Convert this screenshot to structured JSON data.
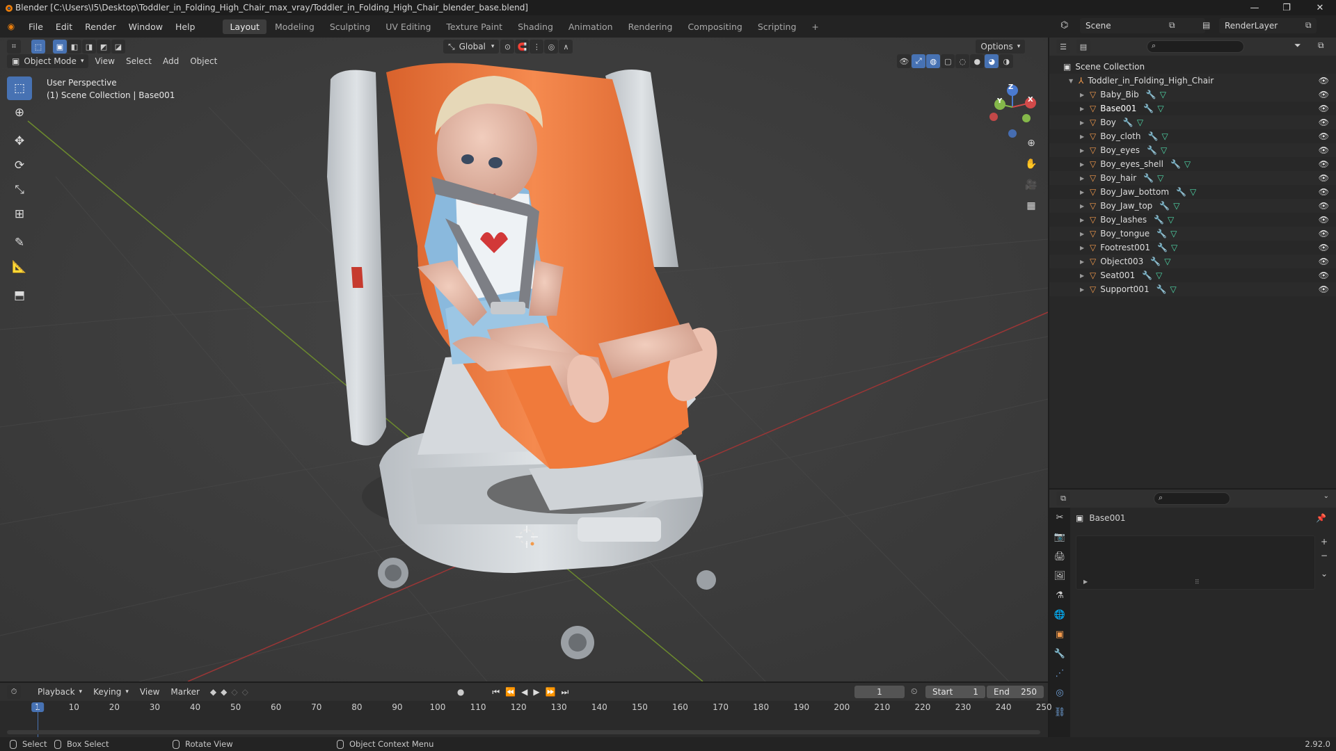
{
  "window": {
    "title": "Blender [C:\\Users\\I5\\Desktop\\Toddler_in_Folding_High_Chair_max_vray/Toddler_in_Folding_High_Chair_blender_base.blend]",
    "minimize": "—",
    "maximize": "❐",
    "close": "✕"
  },
  "menu": {
    "items": [
      "File",
      "Edit",
      "Render",
      "Window",
      "Help"
    ],
    "workspaces": [
      "Layout",
      "Modeling",
      "Sculpting",
      "UV Editing",
      "Texture Paint",
      "Shading",
      "Animation",
      "Rendering",
      "Compositing",
      "Scripting"
    ],
    "active_workspace": "Layout",
    "add_tab": "+",
    "scene": "Scene",
    "view_layer": "RenderLayer"
  },
  "viewport": {
    "mode": "Object Mode",
    "menus": [
      "View",
      "Select",
      "Add",
      "Object"
    ],
    "transform_orientation": "Global",
    "options": "Options",
    "info_line1": "User Perspective",
    "info_line2": "(1) Scene Collection | Base001",
    "gizmo": {
      "x": "X",
      "y": "Y",
      "z": "Z"
    }
  },
  "outliner": {
    "root": "Scene Collection",
    "collection": "Toddler_in_Folding_High_Chair",
    "objects": [
      "Baby_Bib",
      "Base001",
      "Boy",
      "Boy_cloth",
      "Boy_eyes",
      "Boy_eyes_shell",
      "Boy_hair",
      "Boy_Jaw_bottom",
      "Boy_Jaw_top",
      "Boy_lashes",
      "Boy_tongue",
      "Footrest001",
      "Object003",
      "Seat001",
      "Support001"
    ],
    "selected": "Base001"
  },
  "properties": {
    "object_name": "Base001",
    "add": "+",
    "remove": "−",
    "more": "⌄"
  },
  "timeline": {
    "menus": [
      "Playback",
      "Keying",
      "View",
      "Marker"
    ],
    "current_frame": "1",
    "start_label": "Start",
    "start": "1",
    "end_label": "End",
    "end": "250",
    "ticks": [
      "1",
      "10",
      "20",
      "30",
      "40",
      "50",
      "60",
      "70",
      "80",
      "90",
      "100",
      "110",
      "120",
      "130",
      "140",
      "150",
      "160",
      "170",
      "180",
      "190",
      "200",
      "210",
      "220",
      "230",
      "240",
      "250"
    ]
  },
  "status": {
    "select": "Select",
    "box_select": "Box Select",
    "rotate_view": "Rotate View",
    "context_menu": "Object Context Menu",
    "version": "2.92.0"
  },
  "colors": {
    "accent": "#4772b3",
    "object_icon": "#f29a4c",
    "mesh_icon": "#4fd8a8",
    "seat_orange": "#f27a3c",
    "chair_white": "#c9ced3"
  }
}
